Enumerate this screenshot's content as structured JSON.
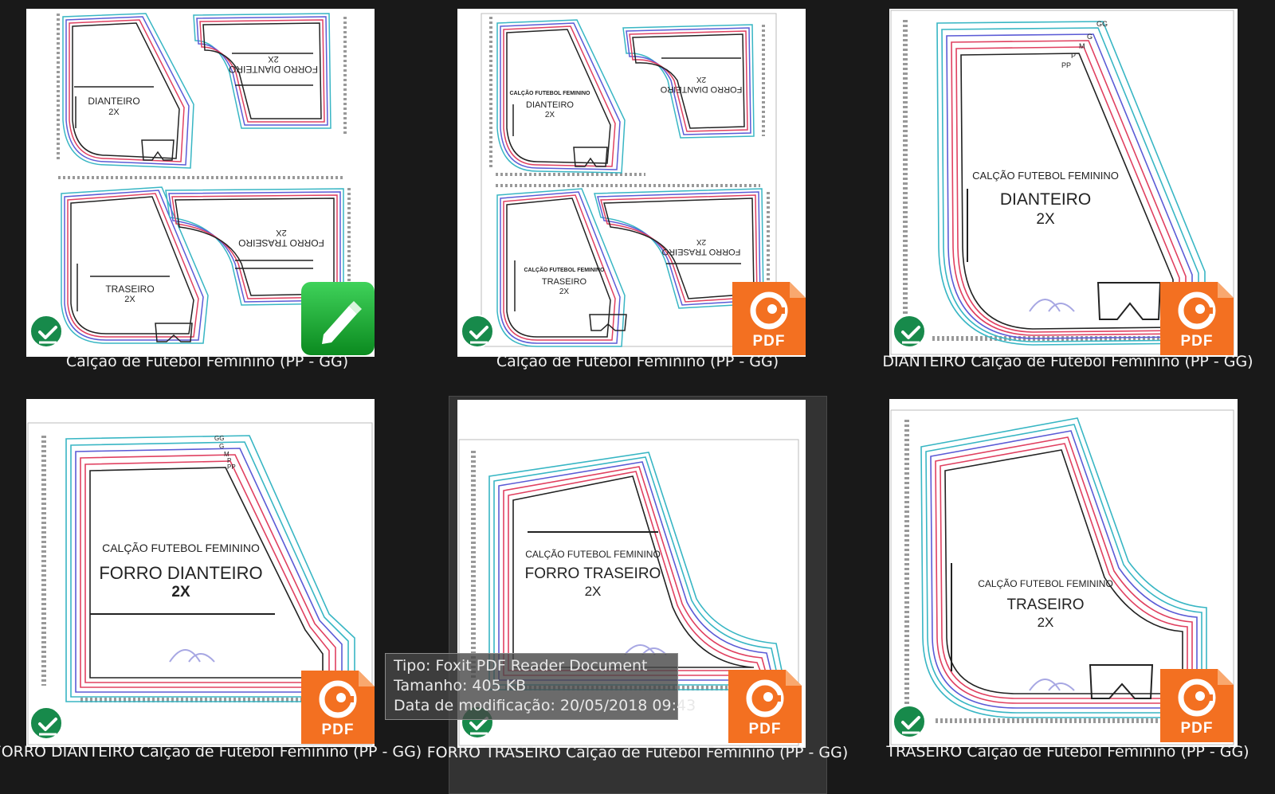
{
  "files": [
    {
      "name": "Calção de Futebol Feminino (PP - GG)",
      "type_icon": "pencil-doc-icon",
      "status_icon": "sync-check-icon",
      "preview": [
        "DIANTEIRO",
        "2X",
        "FORRO DIANTEIRO",
        "2X",
        "TRASEIRO",
        "2X",
        "FORRO TRASEIRO",
        "2X"
      ]
    },
    {
      "name": "Calção de Futebol Feminino (PP - GG)",
      "type_icon": "pdf-icon",
      "status_icon": "sync-check-icon",
      "preview": [
        "CALÇÃO FUTEBOL FEMININO",
        "DIANTEIRO",
        "2X",
        "FORRO DIANTEIRO",
        "2X",
        "CALÇÃO FUTEBOL FEMININO",
        "TRASEIRO",
        "2X",
        "FORRO TRASEIRO",
        "2X"
      ]
    },
    {
      "name": "DIANTEIRO Calção de Futebol Feminino (PP - GG)",
      "type_icon": "pdf-icon",
      "status_icon": "sync-check-icon",
      "preview": [
        "CALÇÃO FUTEBOL FEMININO",
        "DIANTEIRO",
        "2X"
      ],
      "sizes": [
        "GG",
        "G",
        "M",
        "P",
        "PP"
      ]
    },
    {
      "name": "FORRO DIANTEIRO Calção de Futebol Feminino (PP - GG)",
      "type_icon": "pdf-icon",
      "status_icon": "sync-check-icon",
      "preview": [
        "CALÇÃO FUTEBOL FEMININO",
        "FORRO DIANTEIRO",
        "2X"
      ],
      "sizes": [
        "GG",
        "G",
        "M",
        "P",
        "PP"
      ]
    },
    {
      "name": "FORRO TRASEIRO Calção de Futebol Feminino (PP - GG)",
      "type_icon": "pdf-icon",
      "status_icon": "sync-check-icon",
      "preview": [
        "CALÇÃO FUTEBOL FEMININO",
        "FORRO TRASEIRO",
        "2X"
      ],
      "hovered": true
    },
    {
      "name": "TRASEIRO Calção de Futebol Feminino (PP - GG)",
      "type_icon": "pdf-icon",
      "status_icon": "sync-check-icon",
      "preview": [
        "CALÇÃO FUTEBOL FEMININO",
        "TRASEIRO",
        "2X"
      ]
    }
  ],
  "tooltip": {
    "type": "Tipo: Foxit PDF Reader Document",
    "size": "Tamanho: 405 KB",
    "modified": "Data de modificação: 20/05/2018 09:43"
  },
  "pdf_badge_label": "PDF",
  "colors": {
    "background": "#191919",
    "pdf_orange": "#f37021",
    "check_green": "#178a4b",
    "pattern_teal": "#38b6c4",
    "pattern_red": "#e04060",
    "pattern_blue": "#5b5bd6"
  }
}
